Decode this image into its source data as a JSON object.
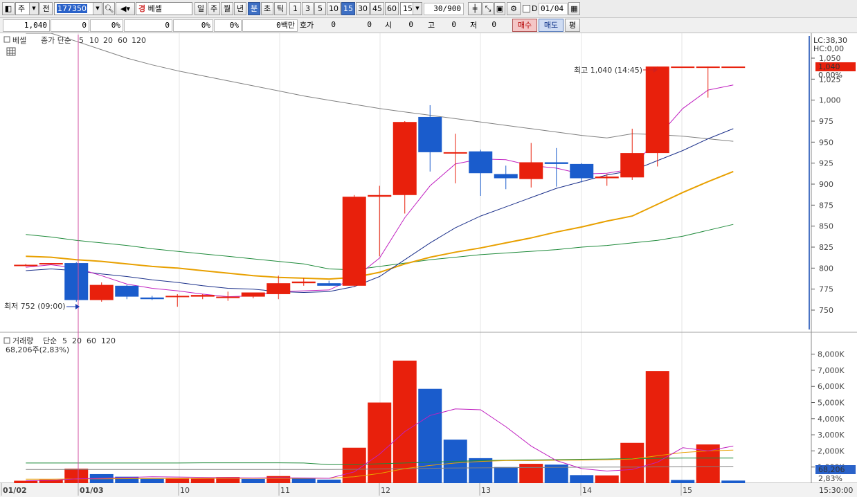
{
  "toolbar": {
    "market": "주",
    "prev_label": "전",
    "code": "177350",
    "stock_name": "베셀",
    "stock_badge": "경",
    "periods": [
      "일",
      "주",
      "월",
      "년",
      "분",
      "초",
      "틱"
    ],
    "active_period": "분",
    "intervals": [
      "1",
      "3",
      "5",
      "10",
      "15",
      "30",
      "45",
      "60"
    ],
    "active_interval": "15",
    "interval_value": "15",
    "count": "30/900",
    "date_checkbox_label": "D",
    "date": "01/04"
  },
  "quote": {
    "price": "1,040",
    "change": "0",
    "change_pct": "0%",
    "volume": "0",
    "vol_pct": "0%",
    "vol2_pct": "0%",
    "amount": "0백만",
    "hoga_label": "호가",
    "hoga1": "0",
    "hoga2": "0",
    "open_label": "시",
    "open": "0",
    "high_label": "고",
    "high": "0",
    "low_label": "저",
    "low": "0",
    "buy_label": "매수",
    "sell_label": "매도",
    "eval_label": "평"
  },
  "price_panel": {
    "title": "베셀",
    "legend_prefix": "종가 단순",
    "ma_periods": [
      "5",
      "10",
      "20",
      "60",
      "120"
    ],
    "ma_colors": [
      "#c020c0",
      "#1a2f8a",
      "#e8a000",
      "#1e8a3a",
      "#808080"
    ],
    "lc_label": "LC:38,30",
    "hc_label": "HC:0,00",
    "last_price_label": "1,040",
    "last_pct_label": "0,00%",
    "high_annotation": "최고 1,040 (14:45)",
    "low_annotation": "최저 752 (09:00)"
  },
  "volume_panel": {
    "title": "거래량",
    "legend_prefix": "단순",
    "ma_periods": [
      "5",
      "20",
      "60",
      "120"
    ],
    "subtitle": "68,206주(2,83%)",
    "last_volume_label": "68,206",
    "last_pct_label": "2,83%"
  },
  "time_axis": {
    "labels": [
      "01/02",
      "01/03",
      "10",
      "11",
      "12",
      "13",
      "14",
      "15"
    ],
    "end_time": "15:30:00"
  },
  "colors": {
    "up": "#e8200c",
    "down": "#1a5ccc",
    "selected_marker": "#c04090"
  },
  "chart_data": {
    "type": "candlestick",
    "price_axis": {
      "ticks": [
        750,
        775,
        800,
        825,
        850,
        875,
        900,
        925,
        950,
        975,
        1000,
        1025,
        1050
      ],
      "tick_labels": [
        "750",
        "775",
        "800",
        "825",
        "850",
        "875",
        "900",
        "925",
        "950",
        "975",
        "1,000",
        "1,025",
        "1,050"
      ],
      "range": [
        730,
        1060
      ]
    },
    "volume_axis": {
      "ticks": [
        1000000,
        2000000,
        3000000,
        4000000,
        5000000,
        6000000,
        7000000,
        8000000
      ],
      "tick_labels": [
        "1,000K",
        "2,000K",
        "3,000K",
        "4,000K",
        "5,000K",
        "6,000K",
        "7,000K",
        "8,000K"
      ],
      "range": [
        0,
        8500000
      ]
    },
    "candles": [
      {
        "o": 803,
        "h": 805,
        "l": 802,
        "c": 804
      },
      {
        "o": 805,
        "h": 806,
        "l": 805,
        "c": 806
      },
      {
        "o": 806,
        "h": 807,
        "l": 760,
        "c": 762
      },
      {
        "o": 762,
        "h": 783,
        "l": 760,
        "c": 780
      },
      {
        "o": 779,
        "h": 780,
        "l": 763,
        "c": 766
      },
      {
        "o": 765,
        "h": 767,
        "l": 762,
        "c": 763
      },
      {
        "o": 766,
        "h": 769,
        "l": 754,
        "c": 767
      },
      {
        "o": 766,
        "h": 769,
        "l": 763,
        "c": 768
      },
      {
        "o": 765,
        "h": 772,
        "l": 761,
        "c": 766
      },
      {
        "o": 766,
        "h": 770,
        "l": 764,
        "c": 771
      },
      {
        "o": 769,
        "h": 791,
        "l": 763,
        "c": 782
      },
      {
        "o": 782,
        "h": 788,
        "l": 779,
        "c": 784
      },
      {
        "o": 782,
        "h": 785,
        "l": 779,
        "c": 779
      },
      {
        "o": 779,
        "h": 887,
        "l": 778,
        "c": 885
      },
      {
        "o": 885,
        "h": 898,
        "l": 814,
        "c": 887
      },
      {
        "o": 887,
        "h": 975,
        "l": 865,
        "c": 974
      },
      {
        "o": 980,
        "h": 994,
        "l": 915,
        "c": 938
      },
      {
        "o": 938,
        "h": 960,
        "l": 901,
        "c": 938
      },
      {
        "o": 939,
        "h": 941,
        "l": 886,
        "c": 913
      },
      {
        "o": 912,
        "h": 922,
        "l": 894,
        "c": 907
      },
      {
        "o": 906,
        "h": 949,
        "l": 896,
        "c": 926
      },
      {
        "o": 926,
        "h": 943,
        "l": 897,
        "c": 924
      },
      {
        "o": 924,
        "h": 925,
        "l": 902,
        "c": 907
      },
      {
        "o": 907,
        "h": 912,
        "l": 898,
        "c": 909
      },
      {
        "o": 908,
        "h": 966,
        "l": 905,
        "c": 937
      },
      {
        "o": 937,
        "h": 1040,
        "l": 921,
        "c": 1040
      },
      {
        "o": 1040,
        "h": 1040,
        "l": 1040,
        "c": 1040
      },
      {
        "o": 1040,
        "h": 1040,
        "l": 1003,
        "c": 1040
      },
      {
        "o": 1040,
        "h": 1040,
        "l": 1040,
        "c": 1040
      }
    ],
    "volumes": [
      150000,
      220000,
      900000,
      560000,
      400000,
      280000,
      320000,
      300000,
      380000,
      260000,
      440000,
      280000,
      220000,
      2200000,
      5000000,
      7600000,
      5850000,
      2700000,
      1550000,
      1000000,
      1200000,
      1150000,
      500000,
      480000,
      2500000,
      6950000,
      200000,
      2400000,
      160000
    ],
    "volume_up": [
      true,
      true,
      true,
      false,
      false,
      false,
      true,
      true,
      true,
      false,
      true,
      false,
      false,
      true,
      true,
      true,
      false,
      false,
      false,
      false,
      true,
      false,
      false,
      true,
      true,
      true,
      false,
      true,
      false
    ],
    "ma5": [
      801,
      804,
      800,
      791,
      781,
      776,
      773,
      769,
      766,
      767,
      772,
      773,
      774,
      788,
      812,
      860,
      898,
      924,
      930,
      929,
      922,
      919,
      912,
      913,
      918,
      956,
      990,
      1012,
      1018
    ],
    "ma10": [
      797,
      799,
      797,
      793,
      790,
      786,
      783,
      779,
      776,
      775,
      772,
      771,
      772,
      778,
      790,
      810,
      830,
      848,
      862,
      873,
      884,
      895,
      903,
      911,
      916,
      928,
      940,
      954,
      966
    ],
    "ma20": [
      814,
      813,
      810,
      808,
      805,
      802,
      800,
      797,
      794,
      791,
      789,
      788,
      787,
      789,
      795,
      805,
      813,
      819,
      824,
      830,
      836,
      843,
      849,
      856,
      862,
      876,
      890,
      903,
      915
    ],
    "ma60": [
      840,
      837,
      833,
      830,
      827,
      823,
      820,
      817,
      814,
      811,
      808,
      805,
      799,
      798,
      802,
      806,
      810,
      813,
      816,
      818,
      820,
      822,
      825,
      827,
      830,
      833,
      838,
      845,
      852
    ],
    "ma120": [
      1090,
      1080,
      1070,
      1060,
      1050,
      1042,
      1035,
      1029,
      1023,
      1017,
      1011,
      1005,
      1000,
      995,
      990,
      986,
      982,
      978,
      974,
      970,
      966,
      962,
      958,
      955,
      960,
      959,
      957,
      954,
      951
    ],
    "vol_ma5": [
      150000,
      170000,
      270000,
      300000,
      350000,
      400000,
      380000,
      360000,
      330000,
      320000,
      330000,
      320000,
      300000,
      700000,
      1800000,
      3200000,
      4200000,
      4600000,
      4550000,
      3500000,
      2300000,
      1400000,
      900000,
      750000,
      850000,
      1300000,
      2200000,
      2000000,
      2300000
    ],
    "vol_ma20": [
      250000,
      250000,
      260000,
      270000,
      280000,
      290000,
      290000,
      300000,
      300000,
      300000,
      300000,
      300000,
      300000,
      400000,
      600000,
      900000,
      1100000,
      1250000,
      1350000,
      1400000,
      1400000,
      1420000,
      1430000,
      1450000,
      1500000,
      1700000,
      1900000,
      2000000,
      2050000
    ],
    "vol_ma60": [
      1250000,
      1250000,
      1250000,
      1250000,
      1250000,
      1250000,
      1250000,
      1260000,
      1260000,
      1260000,
      1260000,
      1250000,
      1150000,
      1150000,
      1200000,
      1250000,
      1300000,
      1350000,
      1400000,
      1420000,
      1440000,
      1460000,
      1480000,
      1500000,
      1520000,
      1540000,
      1560000,
      1560000,
      1560000
    ],
    "vol_ma120": [
      850000,
      850000,
      850000,
      850000,
      850000,
      850000,
      850000,
      850000,
      850000,
      850000,
      850000,
      850000,
      850000,
      860000,
      880000,
      900000,
      920000,
      940000,
      950000,
      960000,
      970000,
      980000,
      990000,
      1000000,
      1000000,
      1010000,
      1020000,
      1030000,
      1040000
    ]
  }
}
